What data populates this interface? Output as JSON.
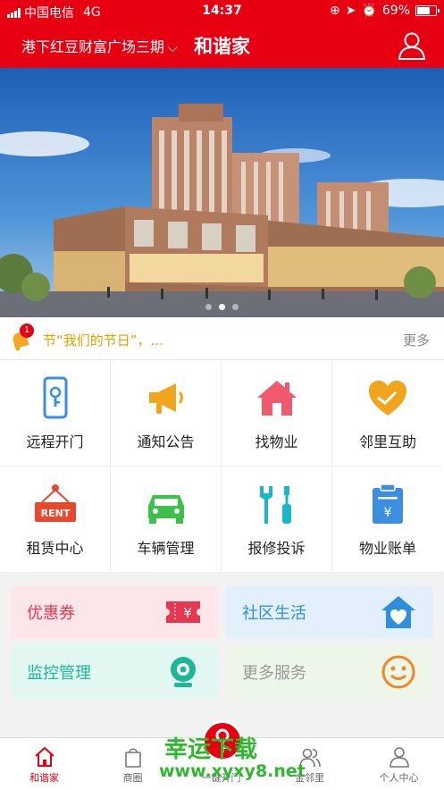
{
  "status_bar": {
    "carrier": "中国电信",
    "network": "4G",
    "time": "14:37",
    "battery": "69%"
  },
  "header": {
    "location": "港下红豆财富广场三期",
    "app_title": "和谐家",
    "icons": {
      "dropdown": "chevron-down-icon",
      "profile": "user-icon"
    }
  },
  "banner": {
    "slide_count": 3,
    "active_slide": 2
  },
  "notice": {
    "badge_count": "1",
    "text": "节“我们的节日”，...",
    "more_label": "更多",
    "icon": "bell-icon"
  },
  "services": [
    {
      "label": "远程开门",
      "icon": "phone-key-icon",
      "color": "#3b8ee0"
    },
    {
      "label": "通知公告",
      "icon": "megaphone-icon",
      "color": "#f0a51c"
    },
    {
      "label": "找物业",
      "icon": "house-icon",
      "color": "#f05a6e"
    },
    {
      "label": "邻里互助",
      "icon": "heart-hand-icon",
      "color": "#f0a51c"
    },
    {
      "label": "租赁中心",
      "icon": "rent-sign-icon",
      "color": "#e8482e"
    },
    {
      "label": "车辆管理",
      "icon": "car-icon",
      "color": "#3cc04a"
    },
    {
      "label": "报修投诉",
      "icon": "wrench-screwdriver-icon",
      "color": "#1fb5c8"
    },
    {
      "label": "物业账单",
      "icon": "bill-icon",
      "color": "#3b8ee0"
    }
  ],
  "rent_sign_text": "RENT",
  "cards": [
    {
      "label": "优惠券",
      "icon": "coupon-icon",
      "bg": "#fde6ea",
      "fg": "#e8384f"
    },
    {
      "label": "社区生活",
      "icon": "community-home-icon",
      "bg": "#e3f0fb",
      "fg": "#2f8fde"
    },
    {
      "label": "监控管理",
      "icon": "camera-icon",
      "bg": "#e2f7f1",
      "fg": "#1db89a"
    },
    {
      "label": "更多服务",
      "icon": "smile-icon",
      "bg": "#eef6ea",
      "fg": "#999999"
    }
  ],
  "coupon_symbol": "¥",
  "bottom_nav": [
    {
      "label": "和谐家",
      "icon": "home-icon",
      "active": true
    },
    {
      "label": "商圈",
      "icon": "shopping-bag-icon",
      "active": false
    },
    {
      "label": "一键开门",
      "icon": "key-icon",
      "active": false
    },
    {
      "label": "金邻里",
      "icon": "neighbors-icon",
      "active": false
    },
    {
      "label": "个人中心",
      "icon": "person-icon",
      "active": false
    }
  ],
  "watermark": {
    "line1": "幸运下载",
    "line2": "www.xyxy8.net"
  },
  "colors": {
    "brand": "#e60012",
    "notice_text": "#e6a000"
  }
}
